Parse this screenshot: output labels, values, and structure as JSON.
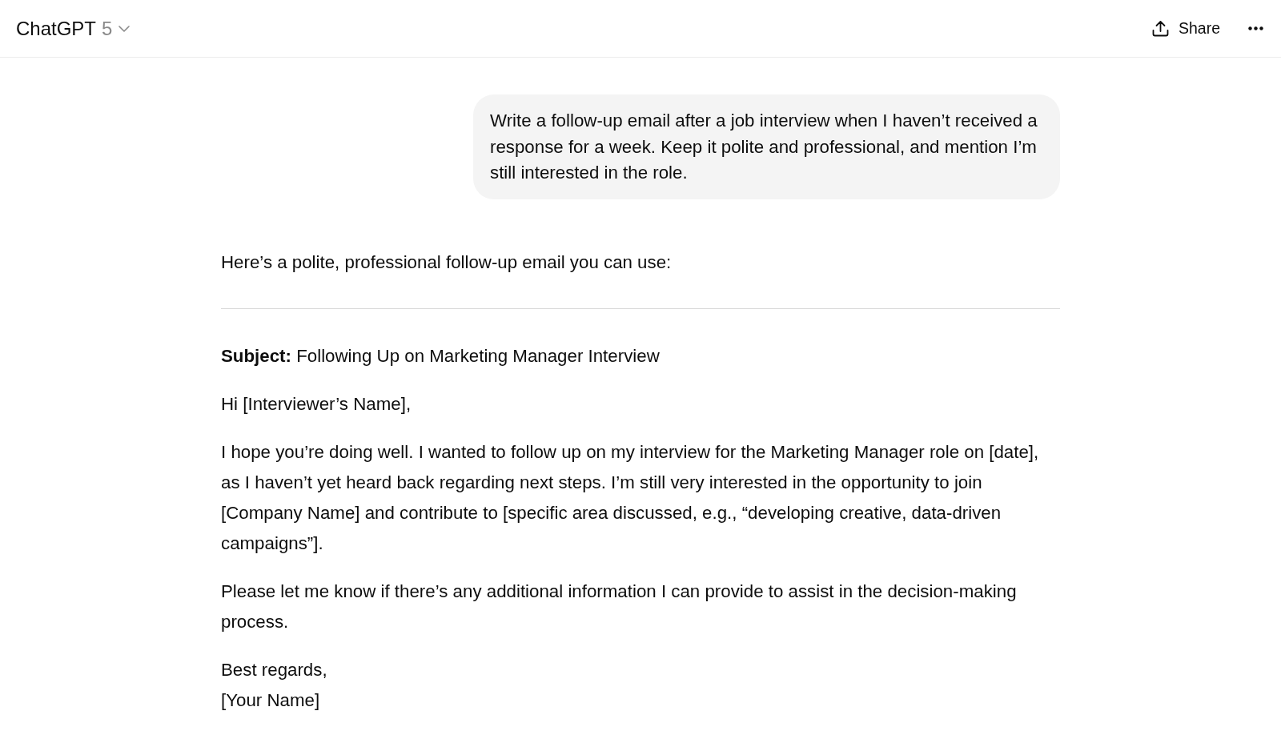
{
  "header": {
    "title": "ChatGPT",
    "version": "5",
    "share_label": "Share"
  },
  "user_message": {
    "text": "Write a follow-up email after a job interview when I haven’t received a response for a week. Keep it polite and professional, and mention I’m still interested in the role."
  },
  "response": {
    "blocks": [
      {
        "kind": "paragraph",
        "text": "Here’s a polite, professional follow-up email you can use:"
      },
      {
        "kind": "rule"
      },
      {
        "kind": "paragraph",
        "text": "**Subject:** Following Up on Marketing Manager Interview"
      },
      {
        "kind": "paragraph",
        "text": "Hi [Interviewer’s Name],"
      },
      {
        "kind": "paragraph",
        "text": "I hope you’re doing well. I wanted to follow up on my interview for the Marketing Manager role on [date], as I haven’t yet heard back regarding next steps. I’m still very interested in the opportunity to join [Company Name] and contribute to [specific area discussed, e.g., “developing creative, data-driven campaigns”]."
      },
      {
        "kind": "paragraph",
        "text": "Please let me know if there’s any additional information I can provide to assist in the decision-making process."
      },
      {
        "kind": "lines",
        "lines": [
          "Best regards,",
          "[Your Name]"
        ]
      }
    ]
  }
}
